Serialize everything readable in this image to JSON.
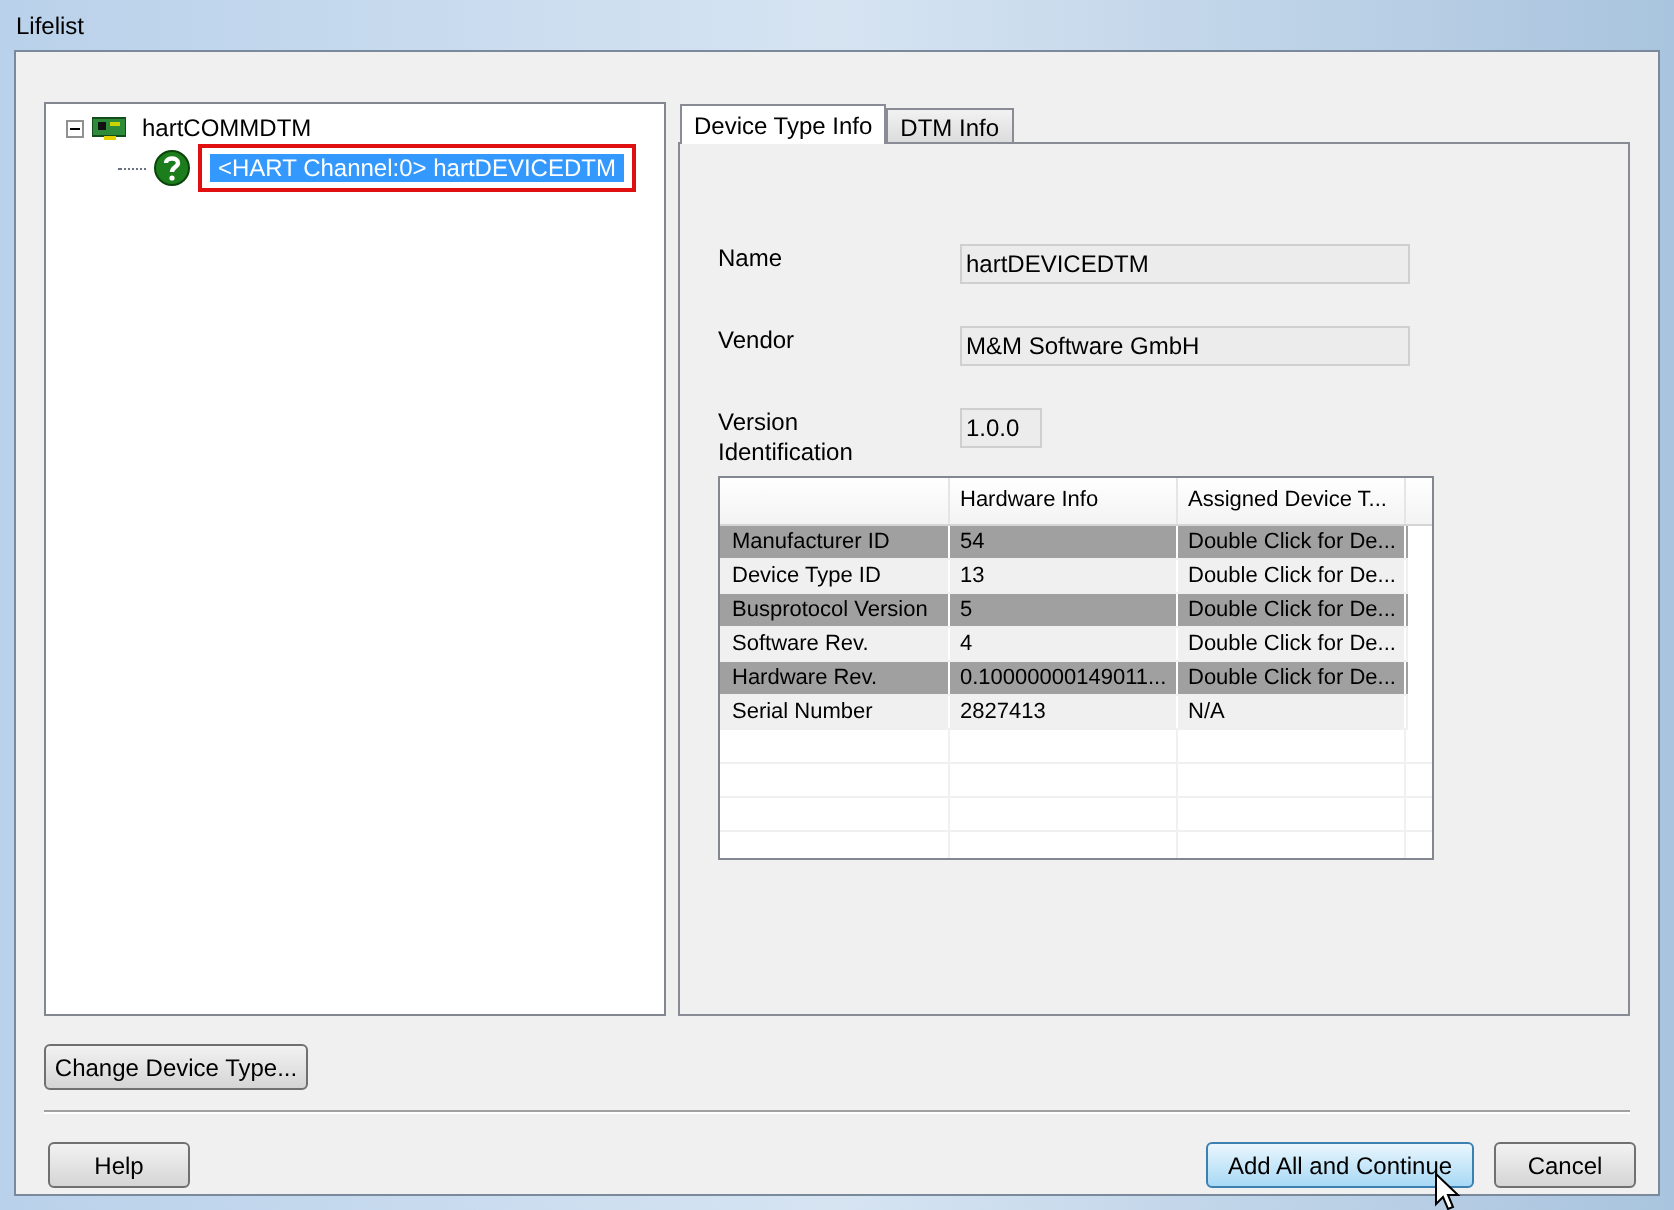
{
  "window": {
    "title": "Lifelist"
  },
  "tree": [
    {
      "label": "hartCOMMDTM",
      "kind": "comm",
      "expanded": true,
      "selected": false,
      "children": [
        {
          "label": "<HART Channel:0> hartDEVICEDTM",
          "kind": "device",
          "selected": true,
          "outlined": true
        }
      ]
    }
  ],
  "tabs": [
    {
      "label": "Device Type Info",
      "selected": true
    },
    {
      "label": "DTM Info",
      "selected": false
    }
  ],
  "fields": [
    {
      "label": "Name",
      "value": "hartDEVICEDTM",
      "kind": "text"
    },
    {
      "label": "Vendor",
      "value": "M&M Software GmbH",
      "kind": "text"
    },
    {
      "label": "Version Identification",
      "value": "1.0.0",
      "kind": "version"
    }
  ],
  "table": {
    "columns": [
      "",
      "Hardware Info",
      "Assigned Device T..."
    ],
    "rows": [
      {
        "cells": [
          "Manufacturer ID",
          "54",
          "Double Click for De..."
        ],
        "shaded": true
      },
      {
        "cells": [
          "Device Type ID",
          "13",
          "Double Click for De..."
        ],
        "shaded": false
      },
      {
        "cells": [
          "Busprotocol Version",
          "5",
          "Double Click for De..."
        ],
        "shaded": true
      },
      {
        "cells": [
          "Software Rev.",
          "4",
          "Double Click for De..."
        ],
        "shaded": false
      },
      {
        "cells": [
          "Hardware Rev.",
          "0.10000000149011...",
          "Double Click for De..."
        ],
        "shaded": true
      },
      {
        "cells": [
          "Serial Number",
          "2827413",
          "N/A"
        ],
        "shaded": false
      }
    ]
  },
  "change_button": {
    "label": "Change Device Type..."
  },
  "footer_buttons": [
    {
      "label": "Help",
      "focused": false
    },
    {
      "label": "Add All and Continue",
      "focused": true
    },
    {
      "label": "Cancel",
      "focused": false
    }
  ]
}
